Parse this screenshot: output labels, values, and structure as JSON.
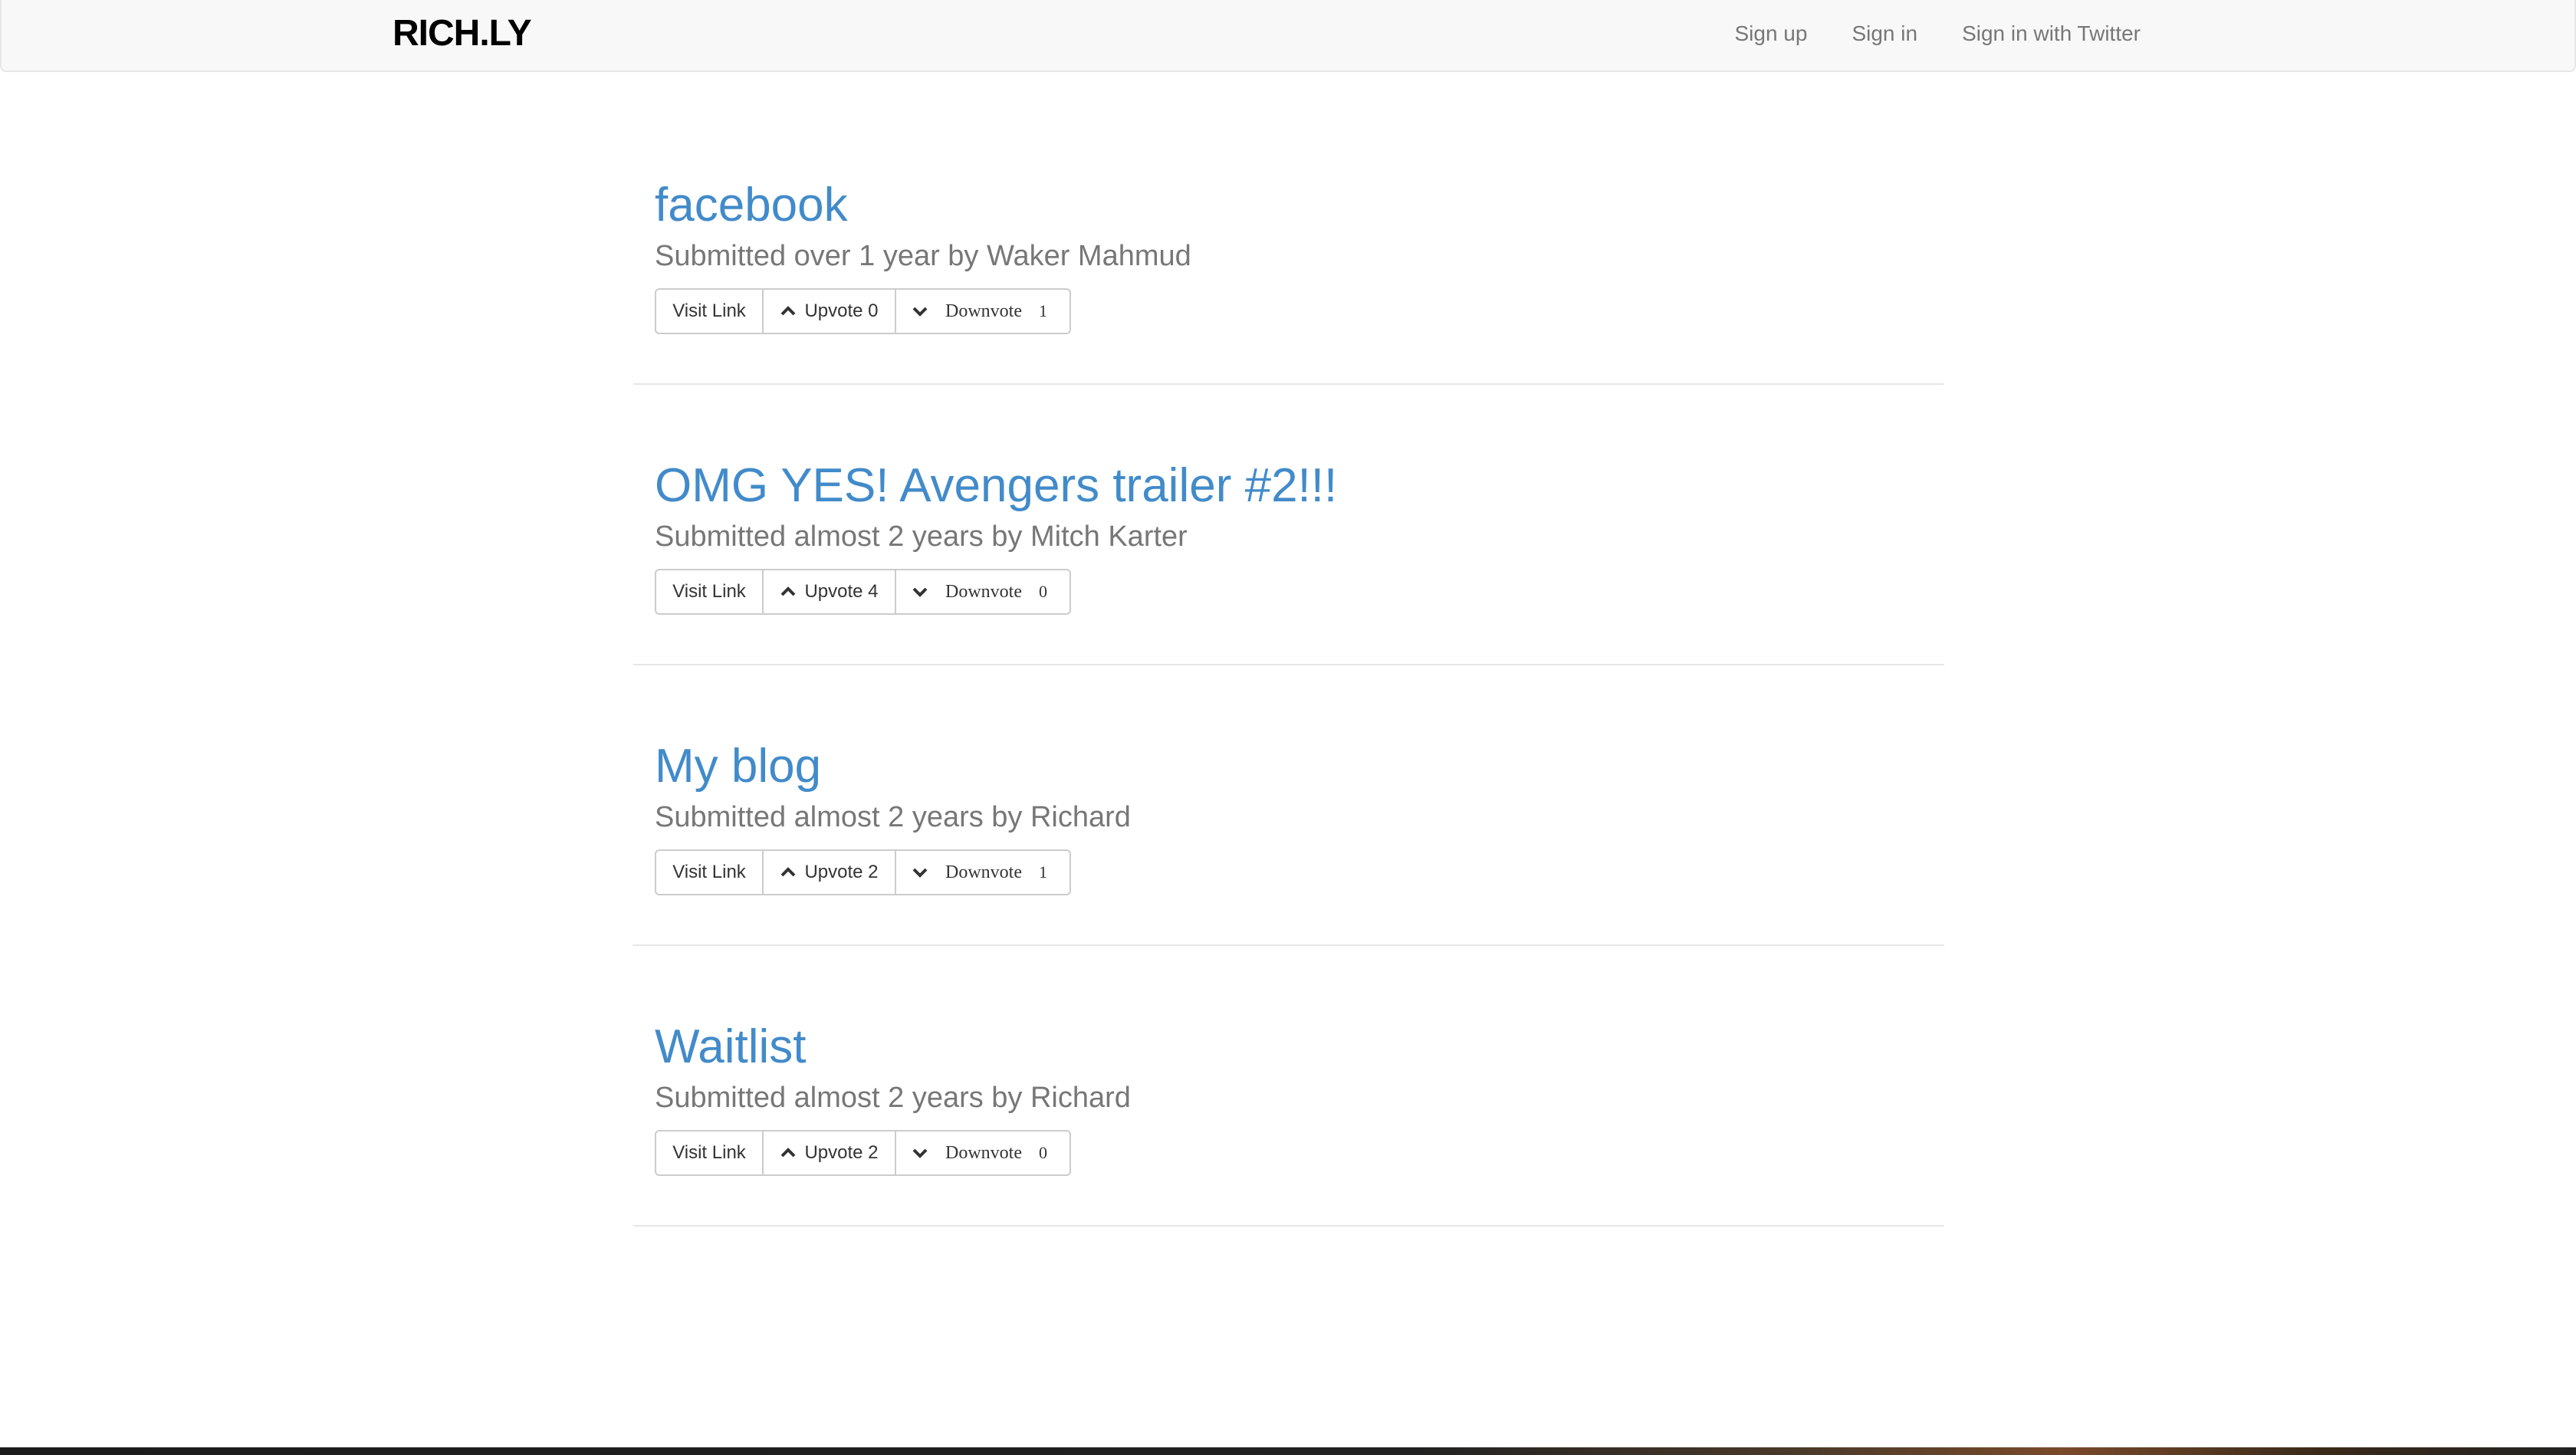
{
  "navbar": {
    "brand": "RICH.LY",
    "links": [
      {
        "label": "Sign up"
      },
      {
        "label": "Sign in"
      },
      {
        "label": "Sign in with Twitter"
      }
    ]
  },
  "posts": [
    {
      "title": "facebook",
      "meta": "Submitted over 1 year by Waker Mahmud",
      "visit_label": "Visit Link",
      "upvote_label": "Upvote 0",
      "downvote_label": "Downvote",
      "downvote_count": "1"
    },
    {
      "title": "OMG YES! Avengers trailer #2!!!",
      "meta": "Submitted almost 2 years by Mitch Karter",
      "visit_label": "Visit Link",
      "upvote_label": "Upvote 4",
      "downvote_label": "Downvote",
      "downvote_count": "0"
    },
    {
      "title": "My blog",
      "meta": "Submitted almost 2 years by Richard",
      "visit_label": "Visit Link",
      "upvote_label": "Upvote 2",
      "downvote_label": "Downvote",
      "downvote_count": "1"
    },
    {
      "title": "Waitlist",
      "meta": "Submitted almost 2 years by Richard",
      "visit_label": "Visit Link",
      "upvote_label": "Upvote 2",
      "downvote_label": "Downvote",
      "downvote_count": "0"
    }
  ],
  "colors": {
    "link": "#428bca",
    "meta": "#777777",
    "navbar_bg": "#f8f8f8"
  }
}
